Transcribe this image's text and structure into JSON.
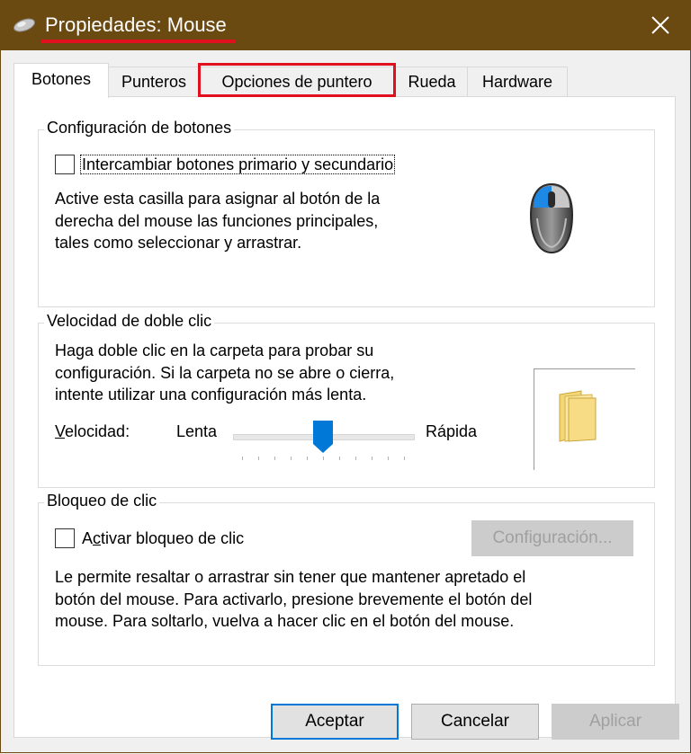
{
  "window": {
    "title": "Propiedades: Mouse",
    "accent_color": "#6b4a12",
    "highlight_color": "#e2101f"
  },
  "tabs": [
    {
      "label": "Botones",
      "active": true
    },
    {
      "label": "Punteros",
      "active": false
    },
    {
      "label": "Opciones de puntero",
      "active": false,
      "highlighted": true
    },
    {
      "label": "Rueda",
      "active": false
    },
    {
      "label": "Hardware",
      "active": false
    }
  ],
  "button_config": {
    "title": "Configuración de botones",
    "checkbox_label": "Intercambiar botones primario y secundario",
    "checked": false,
    "desc_lines": [
      "Active esta casilla para asignar al botón de la",
      "derecha del mouse las funciones principales,",
      "tales como seleccionar y arrastrar."
    ],
    "icon": "mouse-icon"
  },
  "double_click": {
    "title": "Velocidad de doble clic",
    "desc_lines": [
      "Haga doble clic en la carpeta para probar su",
      "configuración. Si la carpeta no se abre o cierra,",
      "intente utilizar una configuración más lenta."
    ],
    "speed_label": "Velocidad:",
    "slow_label": "Lenta",
    "fast_label": "Rápida",
    "slider_value": 0.5,
    "icon": "folder-icon"
  },
  "click_lock": {
    "title": "Bloqueo de clic",
    "checkbox_label": "Activar bloqueo de clic",
    "checked": false,
    "settings_button": "Configuración...",
    "desc_lines": [
      "Le permite resaltar o arrastrar sin tener que mantener apretado el",
      "botón del mouse. Para activarlo, presione brevemente el botón del",
      "mouse. Para soltarlo, vuelva a hacer clic en el botón del mouse."
    ]
  },
  "footer": {
    "ok": "Aceptar",
    "cancel": "Cancelar",
    "apply": "Aplicar"
  }
}
